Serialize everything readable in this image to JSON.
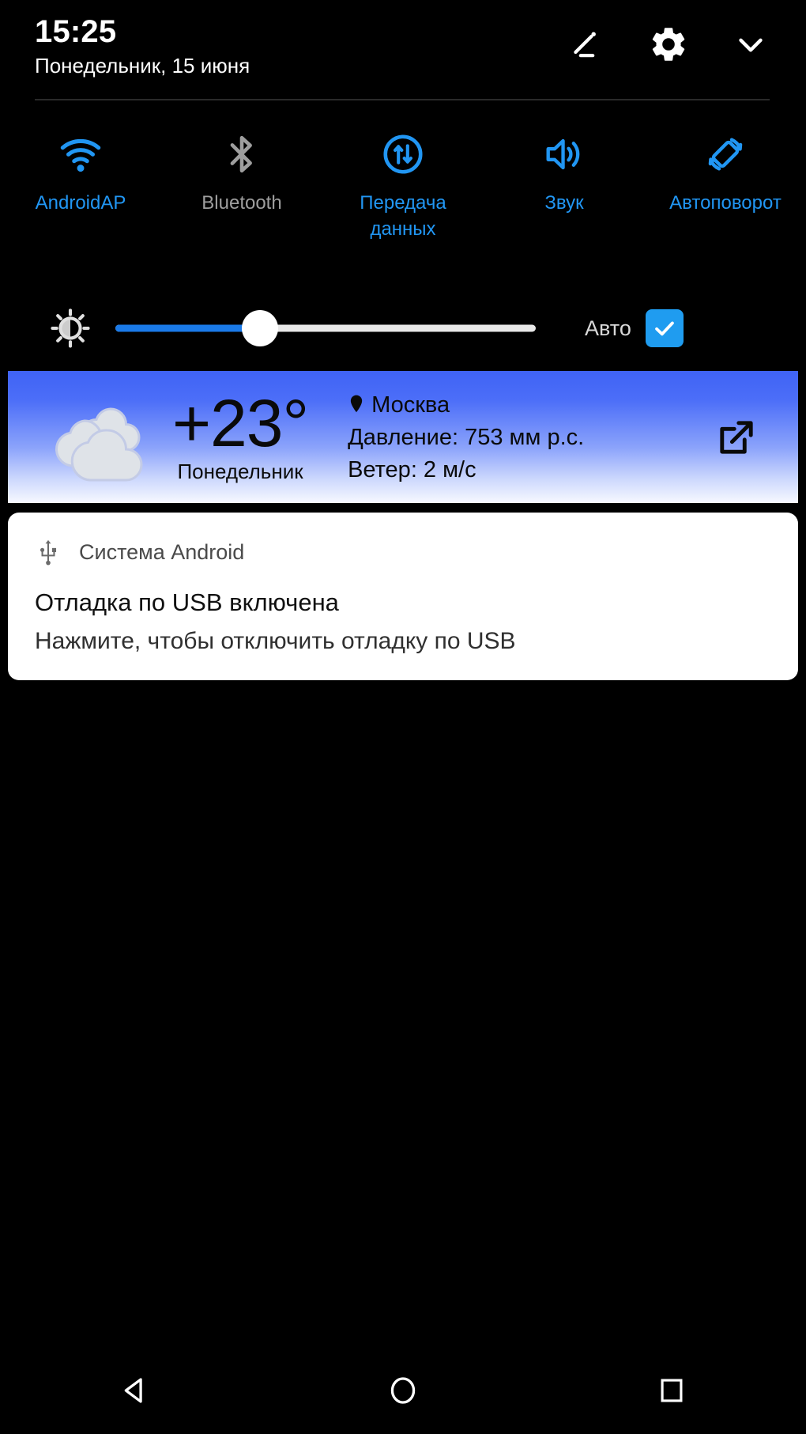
{
  "status_shade": {
    "header": {
      "time": "15:25",
      "date": "Понедельник, 15 июня",
      "edit_icon": "pencil-edit-icon",
      "settings_icon": "gear-icon",
      "collapse_icon": "chevron-down-icon"
    },
    "quick_settings": [
      {
        "label": "AndroidAP",
        "icon": "wifi-icon",
        "state": "on"
      },
      {
        "label": "Bluetooth",
        "icon": "bluetooth-icon",
        "state": "off"
      },
      {
        "label": "Передача данных",
        "icon": "data-transfer-icon",
        "state": "on"
      },
      {
        "label": "Звук",
        "icon": "volume-icon",
        "state": "on"
      },
      {
        "label": "Автоповорот",
        "icon": "auto-rotate-icon",
        "state": "on"
      }
    ],
    "brightness": {
      "icon": "brightness-sun-icon",
      "value_percent": 35,
      "auto_label": "Авто",
      "auto_checked": true,
      "checkbox_icon": "checkmark-icon",
      "accent_color": "#1f9cf0",
      "fill_color": "#1a7ae8"
    },
    "weather": {
      "condition_icon": "overcast-cloud-icon",
      "temperature": "+23°",
      "day": "Понедельник",
      "location_pin_icon": "location-pin-icon",
      "city": "Москва",
      "pressure": "Давление: 753 мм р.с.",
      "wind": "Ветер: 2 м/с",
      "open_icon": "external-link-icon",
      "gradient_top": "#3f63f5",
      "gradient_bottom": "#f7f9ff"
    },
    "notification": {
      "app_icon": "usb-icon",
      "app_name": "Система Android",
      "title": "Отладка по USB включена",
      "body": "Нажмите, чтобы отключить отладку по USB"
    },
    "navigation": {
      "back": "back-triangle-icon",
      "home": "home-circle-icon",
      "recents": "recents-square-icon"
    }
  }
}
